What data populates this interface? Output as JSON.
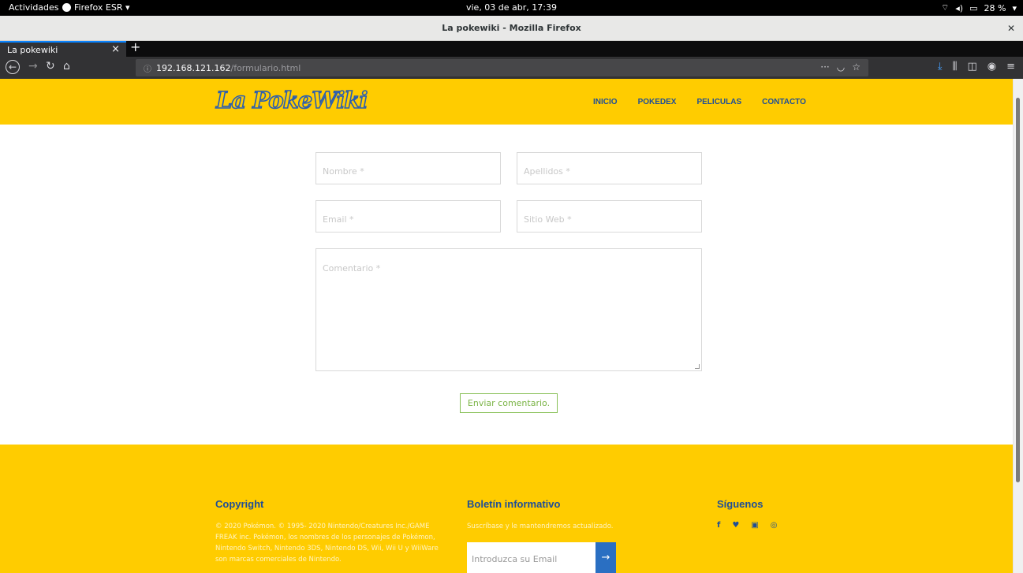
{
  "system": {
    "activities": "Actividades",
    "app_menu": "Firefox ESR ▾",
    "clock": "vie, 03 de abr, 17:39",
    "battery": "28 %"
  },
  "window": {
    "title": "La pokewiki - Mozilla Firefox"
  },
  "tab": {
    "label": "La pokewiki"
  },
  "url": {
    "host": "192.168.121.162",
    "path": "/formulario.html"
  },
  "site": {
    "logo": "La PokeWiki",
    "nav": [
      "INICIO",
      "POKEDEX",
      "PELICULAS",
      "CONTACTO"
    ]
  },
  "form": {
    "nombre_placeholder": "Nombre *",
    "apellidos_placeholder": "Apellidos *",
    "email_placeholder": "Email *",
    "web_placeholder": "Sitio Web *",
    "comentario_placeholder": "Comentario *",
    "submit": "Enviar comentario."
  },
  "footer": {
    "copyright_title": "Copyright",
    "copyright_lines": [
      "© 2020 Pokémon. © 1995- 2020 Nintendo/Creatures Inc./GAME",
      "FREAK inc. Pokémon, los nombres de los personajes de Pokémon,",
      "Nintendo Switch, Nintendo 3DS, Nintendo DS, Wii, Wii U y WiiWare",
      "son marcas comerciales de Nintendo."
    ],
    "newsletter_title": "Boletín informativo",
    "newsletter_text": "Suscríbase y le mantendremos actualizado.",
    "newsletter_placeholder": "Introduzca su Email",
    "follow_title": "Síguenos",
    "social": [
      "facebook-icon",
      "twitter-icon",
      "youtube-icon",
      "instagram-icon"
    ]
  }
}
